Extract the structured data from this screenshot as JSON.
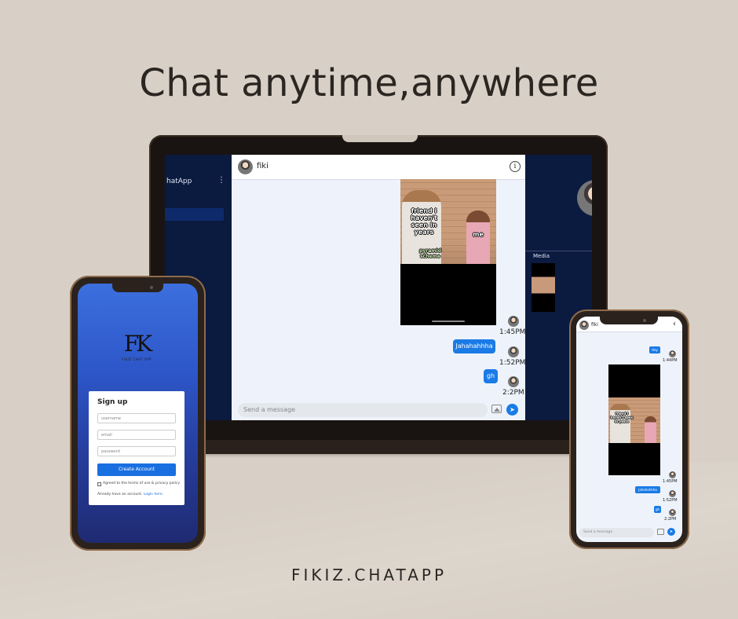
{
  "headline": "Chat anytime,anywhere",
  "footer_brand": "FIKIZ.CHATAPP",
  "colors": {
    "accent": "#1a7be6",
    "background": "#d8d0c6",
    "dark_panel": "#0b1a3f"
  },
  "laptop": {
    "sidebar": {
      "app_title": "hatApp",
      "menu_icon": "more-vert-icon"
    },
    "chat": {
      "contact_name": "fiki",
      "info_icon": "info-icon",
      "meme": {
        "caption_top": "friend i haven't seen in years",
        "caption_me": "me",
        "caption_bottom": "pyramid scheme"
      },
      "messages": [
        {
          "type": "image",
          "time": "1:45PM"
        },
        {
          "type": "text",
          "text": "Jahahahhha",
          "time": "1:52PM"
        },
        {
          "type": "text",
          "text": "gh",
          "time": "2:2PM"
        }
      ],
      "composer_placeholder": "Send a message",
      "image_button_icon": "image-icon",
      "send_button_icon": "send-icon"
    },
    "details_panel": {
      "media_label": "Media"
    }
  },
  "phone_left": {
    "logo_text": "FK",
    "logo_subtitle": "FIKIZ CHAT APP",
    "signup": {
      "title": "Sign up",
      "username_placeholder": "username",
      "email_placeholder": "email",
      "password_placeholder": "password",
      "create_button": "Create Account",
      "agree_text": "Agreed to the terms of use & privacy policy",
      "already_text": "Already have an account.",
      "login_link": "Login here."
    }
  },
  "phone_right": {
    "contact_name": "fiki",
    "back_icon": "chevron-left-icon",
    "messages": [
      {
        "type": "text",
        "text": "Hey",
        "time": "1:44PM"
      },
      {
        "type": "image",
        "time": "1:45PM"
      },
      {
        "type": "text",
        "text": "Jahahahhha",
        "time": "1:52PM"
      },
      {
        "type": "text",
        "text": "gh",
        "time": "2:2PM"
      }
    ],
    "meme_caption": "friend i haven't seen in years",
    "composer_placeholder": "Send a message"
  }
}
